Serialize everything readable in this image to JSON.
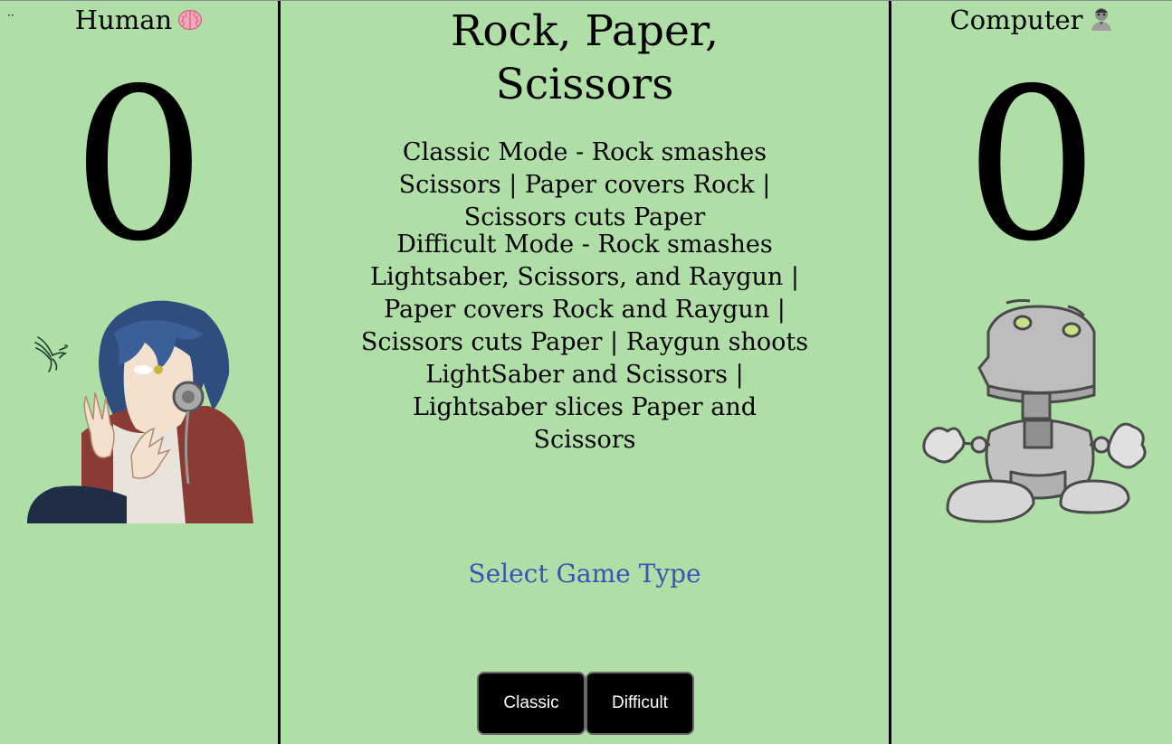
{
  "human": {
    "title": "Human",
    "score": "0",
    "icon": "brain-icon"
  },
  "computer": {
    "title": "Computer",
    "score": "0",
    "icon": "scientist-icon"
  },
  "corner": "··",
  "game": {
    "title": "Rock, Paper, Scissors",
    "classic_rules": "Classic Mode - Rock smashes Scissors | Paper covers Rock | Scissors cuts Paper",
    "difficult_rules": "Difficult Mode - Rock smashes Lightsaber, Scissors, and Raygun | Paper covers Rock and Raygun | Scissors cuts Paper | Raygun shoots LightSaber and Scissors | Lightsaber slices Paper and Scissors",
    "select_prompt": "Select Game Type"
  },
  "buttons": {
    "classic": "Classic",
    "difficult": "Difficult"
  },
  "colors": {
    "background": "#afdea6",
    "prompt": "#3f51b5",
    "button_bg": "#000000"
  }
}
